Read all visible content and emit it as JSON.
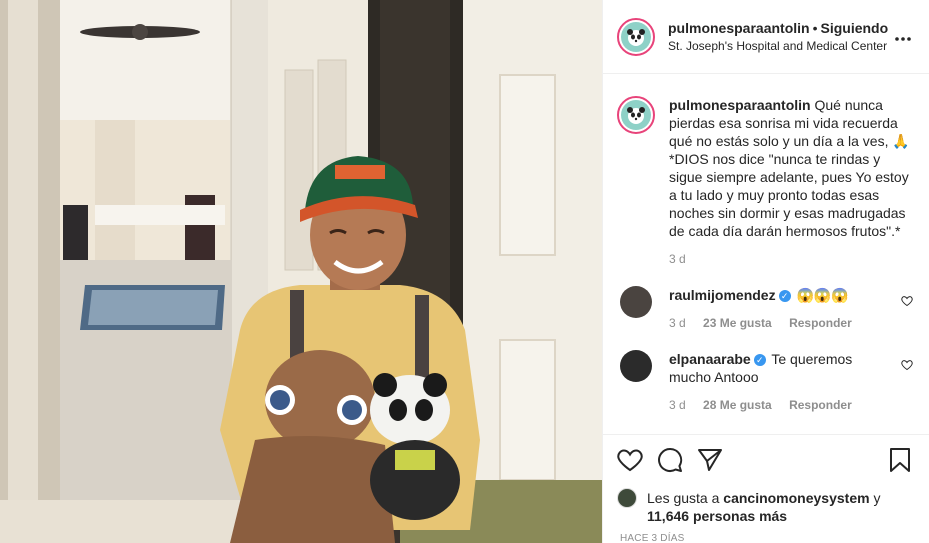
{
  "post": {
    "author": "pulmonesparaantolin",
    "follow_separator": "•",
    "follow_status": "Siguiendo",
    "location": "St. Joseph's Hospital and Medical Center",
    "more_icon": "more-horizontal-icon",
    "caption": {
      "username": "pulmonesparaantolin",
      "text": "Qué nunca pierdas esa sonrisa mi vida recuerda qué no estás solo y un día a la ves, 🙏 *DIOS nos dice \"nunca te rindas y sigue siempre adelante, pues Yo estoy a tu lado y muy pronto todas esas noches sin dormir y esas madrugadas de cada día darán hermosos frutos\".*",
      "time": "3 d"
    },
    "comments": [
      {
        "username": "raulmijomendez",
        "verified": true,
        "text": "😱😱😱",
        "time": "3 d",
        "likes": "23 Me gusta",
        "reply": "Responder",
        "avatar_color": "#4a4440"
      },
      {
        "username": "elpanaarabe",
        "verified": true,
        "text": "Te queremos mucho Antooo",
        "time": "3 d",
        "likes": "28 Me gusta",
        "reply": "Responder",
        "avatar_color": "#2b2b2b"
      }
    ],
    "actions": {
      "like_icon": "heart-icon",
      "comment_icon": "comment-icon",
      "share_icon": "paper-plane-icon",
      "save_icon": "bookmark-icon"
    },
    "likes": {
      "prefix": "Les gusta a",
      "user": "cancinomoneysystem",
      "conj": "y",
      "count": "11,646 personas más"
    },
    "time_ago": "HACE 3 DÍAS",
    "colors": {
      "ring": "#e8437a",
      "verified": "#3897f0",
      "muted": "#8e8e8e",
      "text": "#262626",
      "border": "#efefef"
    }
  }
}
